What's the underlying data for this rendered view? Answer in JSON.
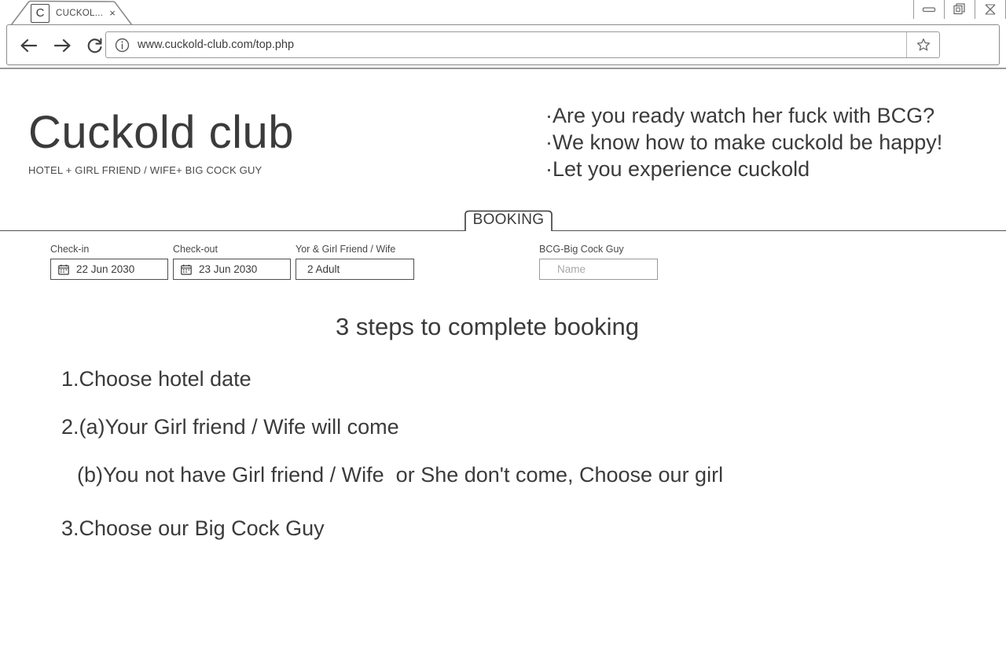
{
  "browser": {
    "tab": {
      "favicon_letter": "C",
      "title": "CUCKOL...",
      "close_icon": "×"
    },
    "window_controls": [
      {
        "name": "minimize",
        "label": "minimize-icon"
      },
      {
        "name": "restore",
        "label": "restore-icon"
      },
      {
        "name": "close",
        "label": "close-icon"
      }
    ],
    "nav": {
      "back": "back-arrow-icon",
      "forward": "forward-arrow-icon",
      "reload": "reload-icon"
    },
    "address": {
      "info_icon": "info-icon",
      "url": "www.cuckold-club.com/top.php",
      "bookmark_icon": "star-icon"
    }
  },
  "site": {
    "logo_title": "Cuckold club",
    "logo_subtitle": "HOTEL + GIRL FRIEND / WIFE+ BIG COCK GUY",
    "taglines": [
      "·Are you ready watch her fuck with BCG?",
      "·We know how to make cuckold be happy!",
      "·Let you experience cuckold"
    ]
  },
  "booking": {
    "tab_label": "BOOKING",
    "fields": {
      "checkin": {
        "label": "Check-in",
        "value": "22 Jun 2030",
        "icon": "calendar-icon"
      },
      "checkout": {
        "label": "Check-out",
        "value": "23 Jun 2030",
        "icon": "calendar-icon"
      },
      "guests": {
        "label": "Yor & Girl Friend / Wife",
        "value": "2 Adult"
      },
      "bcg": {
        "label": "BCG-Big Cock Guy",
        "value": "",
        "placeholder": "Name"
      }
    }
  },
  "content": {
    "heading": "3 steps to complete booking",
    "steps": [
      "1.Choose hotel date",
      "2.(a)Your Girl friend / Wife will come",
      "(b)You not have Girl friend / Wife  or She don't come, Choose our girl",
      "3.Choose our Big Cock Guy"
    ]
  },
  "colors": {
    "text": "#3b3b3b",
    "border": "#4f4f4f",
    "muted": "#a8a8a8",
    "chrome_border": "#8b8b8b"
  }
}
